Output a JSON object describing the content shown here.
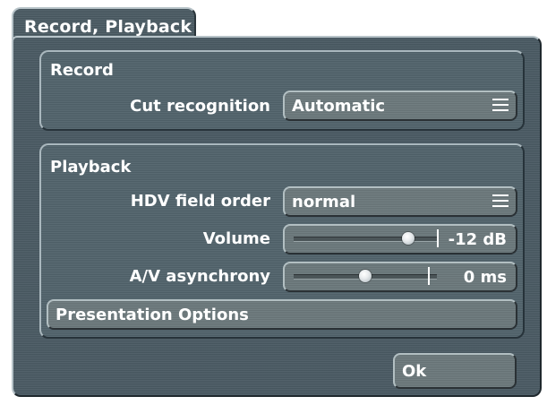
{
  "dialog": {
    "title": "Record, Playback"
  },
  "record": {
    "group_title": "Record",
    "cut_recognition": {
      "label": "Cut recognition",
      "value": "Automatic",
      "icon": "menu-lines-icon"
    }
  },
  "playback": {
    "group_title": "Playback",
    "hdv_field_order": {
      "label": "HDV field order",
      "value": "normal",
      "icon": "menu-lines-icon"
    },
    "volume": {
      "label": "Volume",
      "value_text": "-12 dB",
      "position": 0.8
    },
    "av_async": {
      "label": "A/V asynchrony",
      "value_text": "0 ms",
      "position": 0.5
    },
    "presentation_options": {
      "label": "Presentation Options"
    }
  },
  "footer": {
    "ok_label": "Ok"
  },
  "colors": {
    "background": "#4a5a63",
    "group_background": "#51636c",
    "control_background": "#6b787b",
    "text": "#ffffff"
  }
}
